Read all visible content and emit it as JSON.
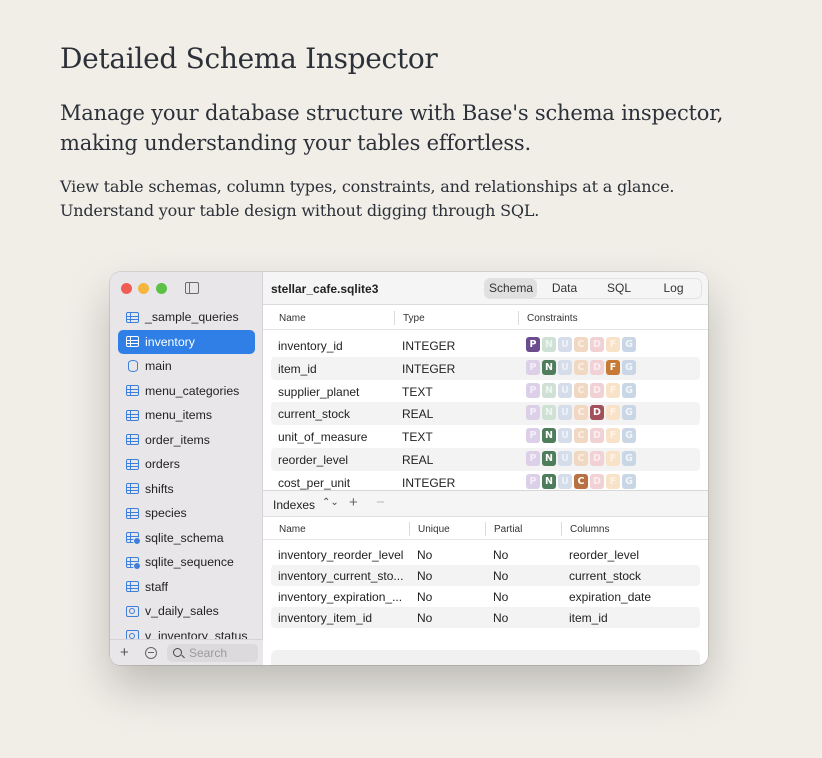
{
  "page": {
    "title": "Detailed Schema Inspector",
    "lead": "Manage your database structure with Base's schema inspector, making understanding your tables effortless.",
    "body": "View table schemas, column types, constraints, and relationships at a glance. Understand your table design without digging through SQL."
  },
  "app": {
    "db_title": "stellar_cafe.sqlite3",
    "tabs": [
      "Schema",
      "Data",
      "SQL",
      "Log"
    ],
    "active_tab": "Schema",
    "sidebar": {
      "items": [
        {
          "label": "_sample_queries",
          "icon": "table-icon"
        },
        {
          "label": "inventory",
          "icon": "table-icon",
          "active": true
        },
        {
          "label": "main",
          "icon": "database-icon"
        },
        {
          "label": "menu_categories",
          "icon": "table-icon"
        },
        {
          "label": "menu_items",
          "icon": "table-icon"
        },
        {
          "label": "order_items",
          "icon": "table-icon"
        },
        {
          "label": "orders",
          "icon": "table-icon"
        },
        {
          "label": "shifts",
          "icon": "table-icon"
        },
        {
          "label": "species",
          "icon": "table-icon"
        },
        {
          "label": "sqlite_schema",
          "icon": "system-table-icon"
        },
        {
          "label": "sqlite_sequence",
          "icon": "system-table-icon"
        },
        {
          "label": "staff",
          "icon": "table-icon"
        },
        {
          "label": "v_daily_sales",
          "icon": "view-icon"
        },
        {
          "label": "v_inventory_status",
          "icon": "view-icon"
        }
      ],
      "add_label": "+",
      "search_placeholder": "Search"
    },
    "columns_header": {
      "name": "Name",
      "type": "Type",
      "constraints": "Constraints"
    },
    "constraint_letters": [
      "P",
      "N",
      "U",
      "C",
      "D",
      "F",
      "G"
    ],
    "columns": [
      {
        "name": "inventory_id",
        "type": "INTEGER",
        "on": [
          "P"
        ]
      },
      {
        "name": "item_id",
        "type": "INTEGER",
        "on": [
          "N",
          "F"
        ]
      },
      {
        "name": "supplier_planet",
        "type": "TEXT",
        "on": []
      },
      {
        "name": "current_stock",
        "type": "REAL",
        "on": [
          "D"
        ]
      },
      {
        "name": "unit_of_measure",
        "type": "TEXT",
        "on": [
          "N"
        ]
      },
      {
        "name": "reorder_level",
        "type": "REAL",
        "on": [
          "N"
        ]
      },
      {
        "name": "cost_per_unit",
        "type": "INTEGER",
        "on": [
          "N",
          "C"
        ]
      }
    ],
    "indexes": {
      "label": "Indexes",
      "updown": "⌃⌄",
      "add": "+",
      "remove": "−",
      "header": {
        "name": "Name",
        "unique": "Unique",
        "partial": "Partial",
        "columns": "Columns"
      },
      "rows": [
        {
          "name": "inventory_reorder_level",
          "unique": "No",
          "partial": "No",
          "columns": "reorder_level"
        },
        {
          "name": "inventory_current_sto...",
          "unique": "No",
          "partial": "No",
          "columns": "current_stock"
        },
        {
          "name": "inventory_expiration_...",
          "unique": "No",
          "partial": "No",
          "columns": "expiration_date"
        },
        {
          "name": "inventory_item_id",
          "unique": "No",
          "partial": "No",
          "columns": "item_id"
        }
      ]
    }
  },
  "colors": {
    "accent": "#2f7fe6",
    "background": "#f1eee8"
  }
}
